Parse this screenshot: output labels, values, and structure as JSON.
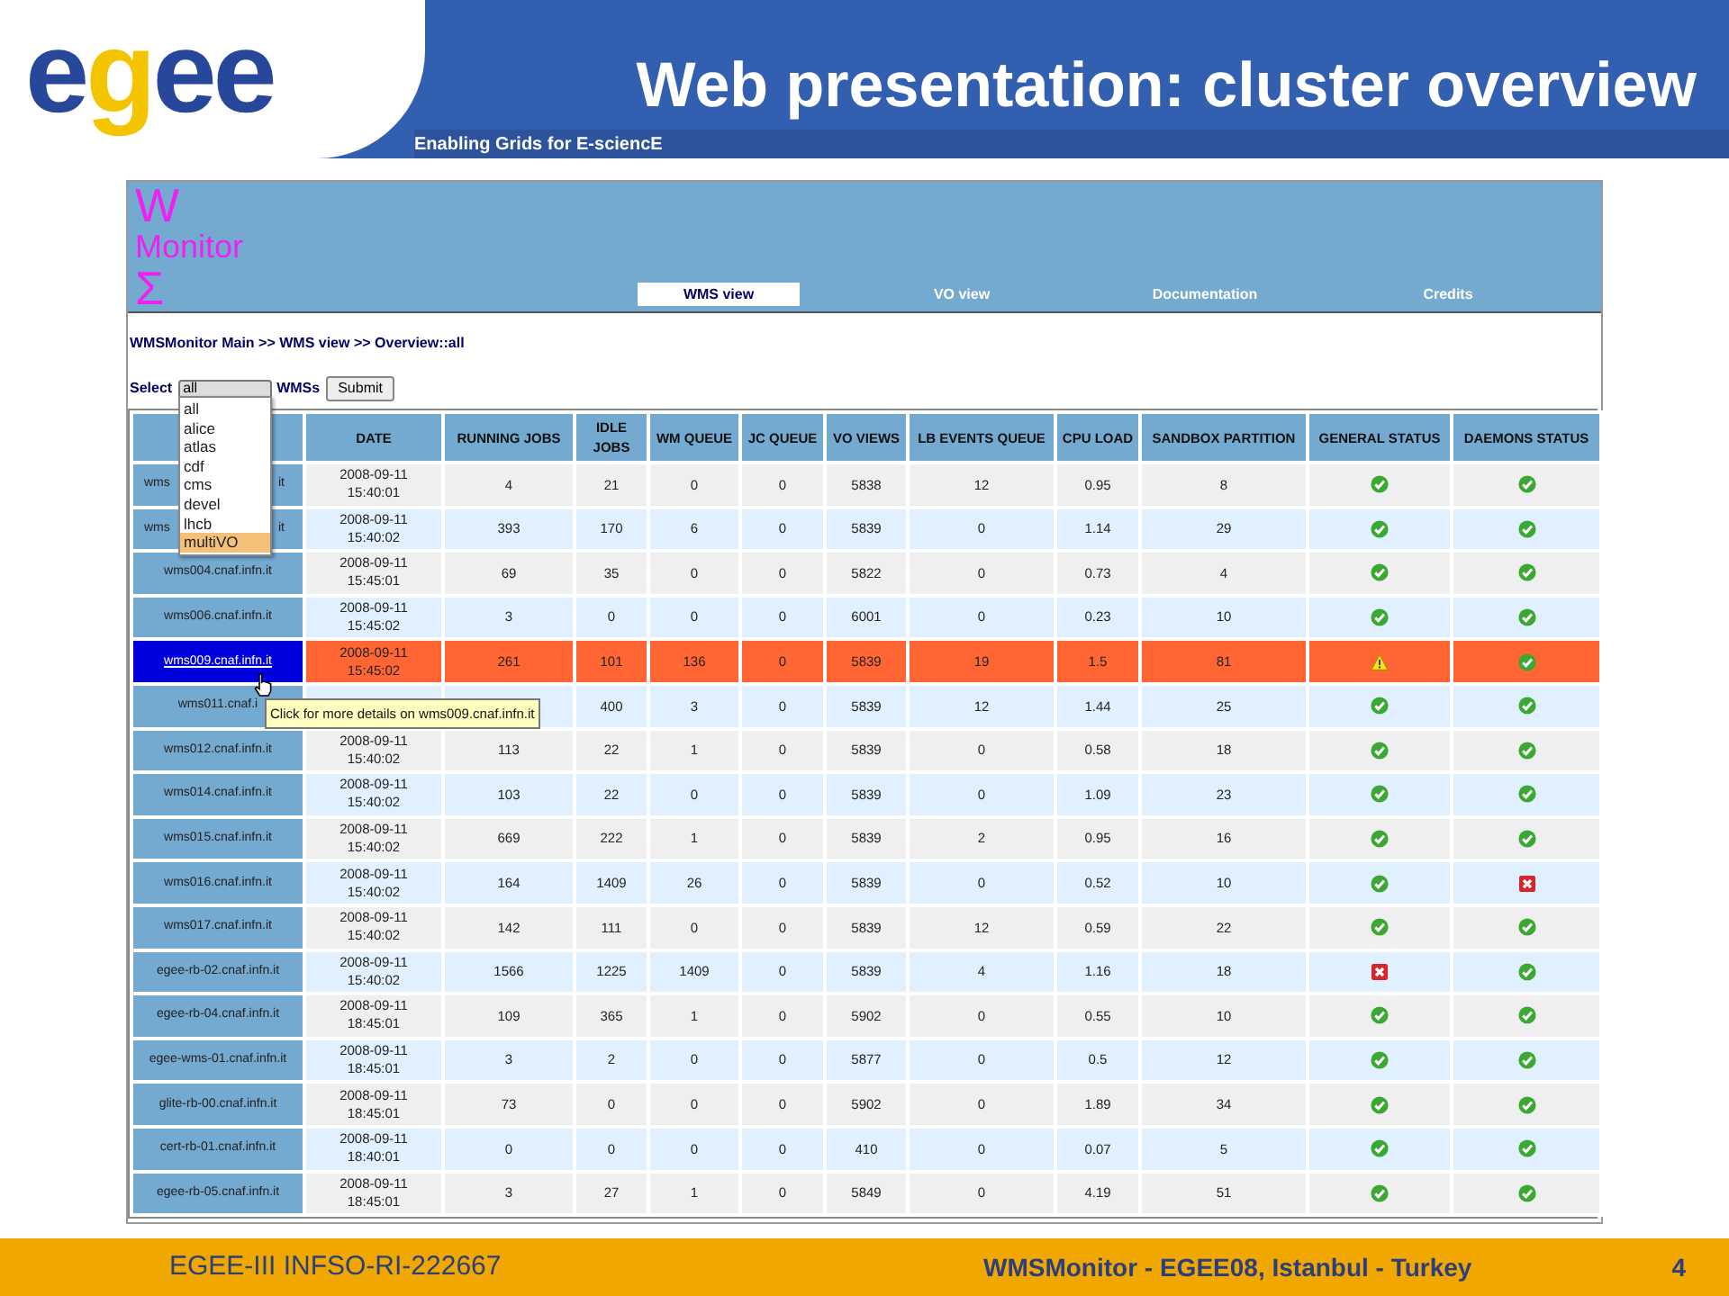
{
  "slide": {
    "logo": "egee",
    "title": "Web presentation: cluster overview",
    "tagline": "Enabling Grids for E-sciencE"
  },
  "app": {
    "logo_lines": [
      "W",
      "Monitor",
      "Σ"
    ],
    "nav": [
      {
        "label": "WMS view",
        "selected": true
      },
      {
        "label": "VO view",
        "selected": false
      },
      {
        "label": "Documentation",
        "selected": false
      },
      {
        "label": "Credits",
        "selected": false
      }
    ],
    "breadcrumb": "WMSMonitor Main >> WMS view >> Overview::all",
    "select_label": "Select",
    "select_value": "all",
    "select_suffix": "WMSs",
    "submit": "Submit",
    "dropdown": [
      {
        "label": "all",
        "selected": false
      },
      {
        "label": "alice",
        "selected": false
      },
      {
        "label": "atlas",
        "selected": false
      },
      {
        "label": "cdf",
        "selected": false
      },
      {
        "label": "cms",
        "selected": false
      },
      {
        "label": "devel",
        "selected": false
      },
      {
        "label": "lhcb",
        "selected": false
      },
      {
        "label": "multiVO",
        "selected": true
      }
    ],
    "columns": [
      "",
      "DATE",
      "RUNNING JOBS",
      "IDLE JOBS",
      "WM QUEUE",
      "JC QUEUE",
      "VO VIEWS",
      "LB EVENTS QUEUE",
      "CPU LOAD",
      "SANDBOX PARTITION",
      "GENERAL STATUS",
      "DAEMONS STATUS"
    ],
    "rows": [
      {
        "cells": [
          "wms it",
          "2008-09-11 15:40:01",
          "4",
          "21",
          "0",
          "0",
          "5838",
          "12",
          "0.95",
          "8"
        ],
        "general": {
          "kind": "ok"
        },
        "daemons": {
          "kind": "ok"
        },
        "highlighted": false
      },
      {
        "cells": [
          "wms it",
          "2008-09-11 15:40:02",
          "393",
          "170",
          "6",
          "0",
          "5839",
          "0",
          "1.14",
          "29"
        ],
        "general": {
          "kind": "ok"
        },
        "daemons": {
          "kind": "ok"
        },
        "highlighted": false
      },
      {
        "cells": [
          "wms004.cnaf.infn.it",
          "2008-09-11 15:45:01",
          "69",
          "35",
          "0",
          "0",
          "5822",
          "0",
          "0.73",
          "4"
        ],
        "general": {
          "kind": "ok"
        },
        "daemons": {
          "kind": "ok"
        },
        "highlighted": false
      },
      {
        "cells": [
          "wms006.cnaf.infn.it",
          "2008-09-11 15:45:02",
          "3",
          "0",
          "0",
          "0",
          "6001",
          "0",
          "0.23",
          "10"
        ],
        "general": {
          "kind": "ok"
        },
        "daemons": {
          "kind": "ok"
        },
        "highlighted": false
      },
      {
        "cells": [
          "wms009.cnaf.infn.it",
          "2008-09-11 15:45:02",
          "261",
          "101",
          "136",
          "0",
          "5839",
          "19",
          "1.5",
          "81"
        ],
        "general": {
          "kind": "warning"
        },
        "daemons": {
          "kind": "ok"
        },
        "highlighted": true
      },
      {
        "cells": [
          "wms011.cnaf.i",
          null,
          null,
          "400",
          "3",
          "0",
          "5839",
          "12",
          "1.44",
          "25"
        ],
        "general": {
          "kind": "ok"
        },
        "daemons": {
          "kind": "ok"
        },
        "highlighted": false
      },
      {
        "cells": [
          "wms012.cnaf.infn.it",
          "2008-09-11 15:40:02",
          "113",
          "22",
          "1",
          "0",
          "5839",
          "0",
          "0.58",
          "18"
        ],
        "general": {
          "kind": "ok"
        },
        "daemons": {
          "kind": "ok"
        },
        "highlighted": false
      },
      {
        "cells": [
          "wms014.cnaf.infn.it",
          "2008-09-11 15:40:02",
          "103",
          "22",
          "0",
          "0",
          "5839",
          "0",
          "1.09",
          "23"
        ],
        "general": {
          "kind": "ok"
        },
        "daemons": {
          "kind": "ok"
        },
        "highlighted": false
      },
      {
        "cells": [
          "wms015.cnaf.infn.it",
          "2008-09-11 15:40:02",
          "669",
          "222",
          "1",
          "0",
          "5839",
          "2",
          "0.95",
          "16"
        ],
        "general": {
          "kind": "ok"
        },
        "daemons": {
          "kind": "ok"
        },
        "highlighted": false
      },
      {
        "cells": [
          "wms016.cnaf.infn.it",
          "2008-09-11 15:40:02",
          "164",
          "1409",
          "26",
          "0",
          "5839",
          "0",
          "0.52",
          "10"
        ],
        "general": {
          "kind": "ok"
        },
        "daemons": {
          "kind": "error"
        },
        "highlighted": false
      },
      {
        "cells": [
          "wms017.cnaf.infn.it",
          "2008-09-11 15:40:02",
          "142",
          "111",
          "0",
          "0",
          "5839",
          "12",
          "0.59",
          "22"
        ],
        "general": {
          "kind": "ok"
        },
        "daemons": {
          "kind": "ok"
        },
        "highlighted": false
      },
      {
        "cells": [
          "egee-rb-02.cnaf.infn.it",
          "2008-09-11 15:40:02",
          "1566",
          "1225",
          "1409",
          "0",
          "5839",
          "4",
          "1.16",
          "18"
        ],
        "general": {
          "kind": "error"
        },
        "daemons": {
          "kind": "ok"
        },
        "highlighted": false
      },
      {
        "cells": [
          "egee-rb-04.cnaf.infn.it",
          "2008-09-11 18:45:01",
          "109",
          "365",
          "1",
          "0",
          "5902",
          "0",
          "0.55",
          "10"
        ],
        "general": {
          "kind": "ok"
        },
        "daemons": {
          "kind": "ok"
        },
        "highlighted": false
      },
      {
        "cells": [
          "egee-wms-01.cnaf.infn.it",
          "2008-09-11 18:45:01",
          "3",
          "2",
          "0",
          "0",
          "5877",
          "0",
          "0.5",
          "12"
        ],
        "general": {
          "kind": "ok"
        },
        "daemons": {
          "kind": "ok"
        },
        "highlighted": false
      },
      {
        "cells": [
          "glite-rb-00.cnaf.infn.it",
          "2008-09-11 18:45:01",
          "73",
          "0",
          "0",
          "0",
          "5902",
          "0",
          "1.89",
          "34"
        ],
        "general": {
          "kind": "ok"
        },
        "daemons": {
          "kind": "ok"
        },
        "highlighted": false
      },
      {
        "cells": [
          "cert-rb-01.cnaf.infn.it",
          "2008-09-11 18:40:01",
          "0",
          "0",
          "0",
          "0",
          "410",
          "0",
          "0.07",
          "5"
        ],
        "general": {
          "kind": "ok"
        },
        "daemons": {
          "kind": "ok"
        },
        "highlighted": false
      },
      {
        "cells": [
          "egee-rb-05.cnaf.infn.it",
          "2008-09-11 18:45:01",
          "3",
          "27",
          "1",
          "0",
          "5849",
          "0",
          "4.19",
          "51"
        ],
        "general": {
          "kind": "ok"
        },
        "daemons": {
          "kind": "ok"
        },
        "highlighted": false
      }
    ],
    "tooltip": "Click for more details on wms009.cnaf.infn.it"
  },
  "footer": {
    "left": "EGEE-III INFSO-RI-222667",
    "center": "WMSMonitor -  EGEE08, Istanbul - Turkey",
    "page": "4"
  }
}
